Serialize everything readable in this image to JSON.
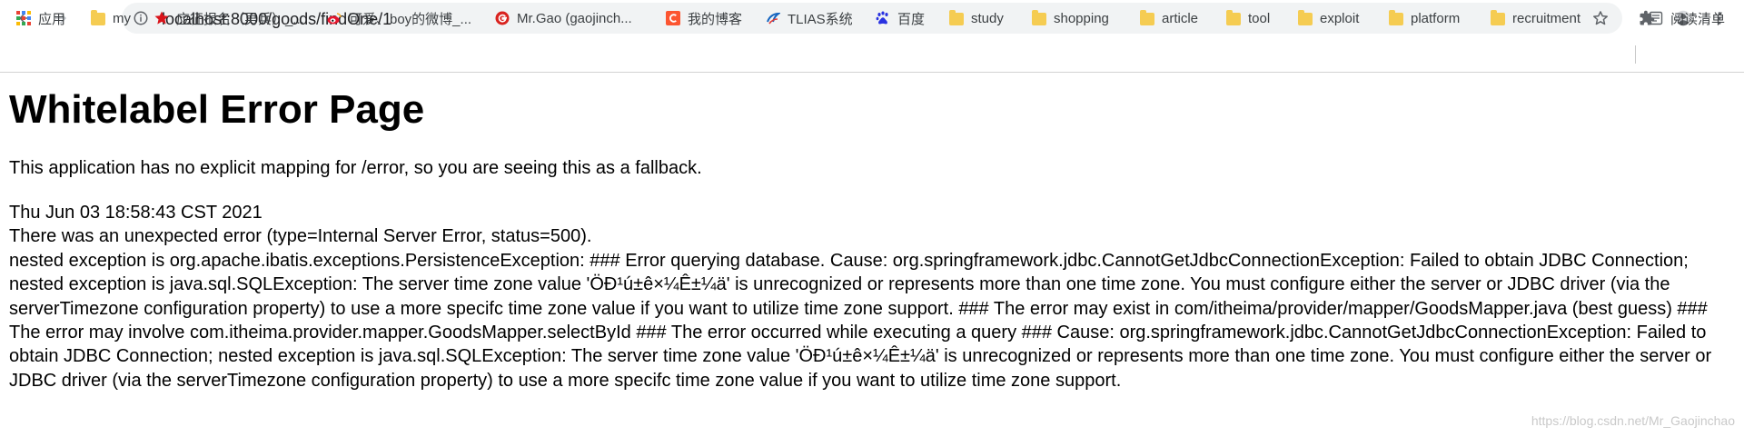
{
  "browser": {
    "url": "localhost:8000/goods/findOne/1",
    "icons": {
      "back": "arrow-left-icon",
      "forward": "arrow-right-icon",
      "reload": "reload-icon",
      "site_info": "info-circle-icon",
      "bookmark_star": "star-icon",
      "extensions": "puzzle-icon",
      "profile": "avatar-icon",
      "menu": "kebab-menu-icon"
    }
  },
  "bookmarks": {
    "items": [
      {
        "label": "应用",
        "icon": "apps-grid-icon"
      },
      {
        "label": "my",
        "icon": "folder-icon"
      },
      {
        "label": "应征报名（男兵）_...",
        "icon": "red-star-icon"
      },
      {
        "label": "可爱、boy的微博_...",
        "icon": "weibo-icon"
      },
      {
        "label": "Mr.Gao (gaojinch...",
        "icon": "github-g-icon"
      },
      {
        "label": "我的博客",
        "icon": "csdn-c-icon"
      },
      {
        "label": "TLIAS系统",
        "icon": "tlias-icon"
      },
      {
        "label": "百度",
        "icon": "baidu-paw-icon"
      },
      {
        "label": "study",
        "icon": "folder-icon"
      },
      {
        "label": "shopping",
        "icon": "folder-icon"
      },
      {
        "label": "article",
        "icon": "folder-icon"
      },
      {
        "label": "tool",
        "icon": "folder-icon"
      },
      {
        "label": "exploit",
        "icon": "folder-icon"
      },
      {
        "label": "platform",
        "icon": "folder-icon"
      },
      {
        "label": "recruitment",
        "icon": "folder-icon"
      }
    ],
    "reading_list": {
      "label": "阅读清单",
      "icon": "reading-list-icon"
    }
  },
  "page": {
    "title": "Whitelabel Error Page",
    "description": "This application has no explicit mapping for /error, so you are seeing this as a fallback.",
    "timestamp": "Thu Jun 03 18:58:43 CST 2021",
    "status_line": "There was an unexpected error (type=Internal Server Error, status=500).",
    "message": "nested exception is org.apache.ibatis.exceptions.PersistenceException: ### Error querying database. Cause: org.springframework.jdbc.CannotGetJdbcConnectionException: Failed to obtain JDBC Connection; nested exception is java.sql.SQLException: The server time zone value 'ÖÐ¹ú±ê×¼Ê±¼ä' is unrecognized or represents more than one time zone. You must configure either the server or JDBC driver (via the serverTimezone configuration property) to use a more specifc time zone value if you want to utilize time zone support. ### The error may exist in com/itheima/provider/mapper/GoodsMapper.java (best guess) ### The error may involve com.itheima.provider.mapper.GoodsMapper.selectById ### The error occurred while executing a query ### Cause: org.springframework.jdbc.CannotGetJdbcConnectionException: Failed to obtain JDBC Connection; nested exception is java.sql.SQLException: The server time zone value 'ÖÐ¹ú±ê×¼Ê±¼ä' is unrecognized or represents more than one time zone. You must configure either the server or JDBC driver (via the serverTimezone configuration property) to use a more specifc time zone value if you want to utilize time zone support."
  },
  "watermark": "https://blog.csdn.net/Mr_Gaojinchao",
  "colors": {
    "omnibox_bg": "#f1f3f4",
    "folder": "#f5cc52",
    "watermark": "#c9c9c9"
  }
}
